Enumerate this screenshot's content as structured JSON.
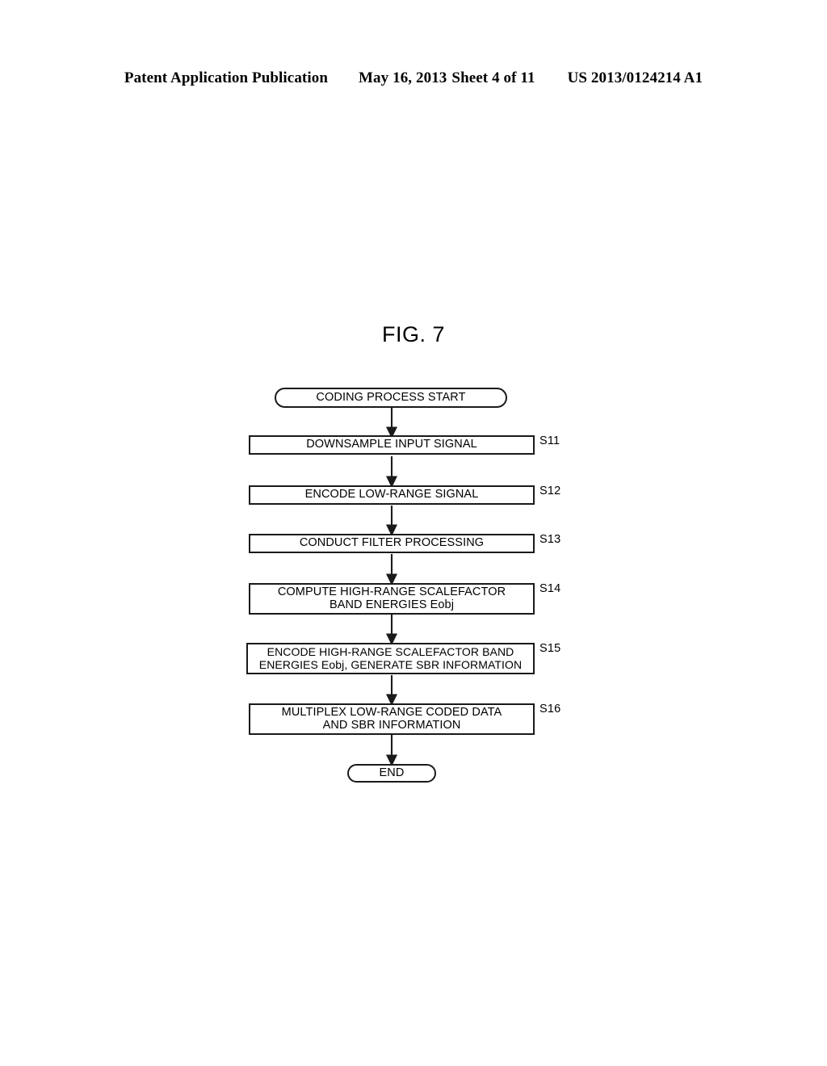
{
  "header": {
    "publication": "Patent Application Publication",
    "date": "May 16, 2013",
    "sheet": "Sheet 4 of 11",
    "patent_number": "US 2013/0124214 A1"
  },
  "figure": {
    "title": "FIG. 7"
  },
  "flowchart": {
    "start": {
      "label": "CODING PROCESS START"
    },
    "end": {
      "label": "END"
    },
    "steps": [
      {
        "step": "S11",
        "line1": "DOWNSAMPLE INPUT SIGNAL",
        "line2": ""
      },
      {
        "step": "S12",
        "line1": "ENCODE LOW-RANGE SIGNAL",
        "line2": ""
      },
      {
        "step": "S13",
        "line1": "CONDUCT FILTER PROCESSING",
        "line2": ""
      },
      {
        "step": "S14",
        "line1": "COMPUTE HIGH-RANGE SCALEFACTOR",
        "line2": "BAND ENERGIES Eobj"
      },
      {
        "step": "S15",
        "line1": "ENCODE HIGH-RANGE SCALEFACTOR BAND",
        "line2": "ENERGIES Eobj, GENERATE SBR INFORMATION"
      },
      {
        "step": "S16",
        "line1": "MULTIPLEX LOW-RANGE CODED DATA",
        "line2": "AND SBR INFORMATION"
      }
    ]
  },
  "colors": {
    "ink": "#1a1a1a",
    "paper": "#ffffff"
  }
}
